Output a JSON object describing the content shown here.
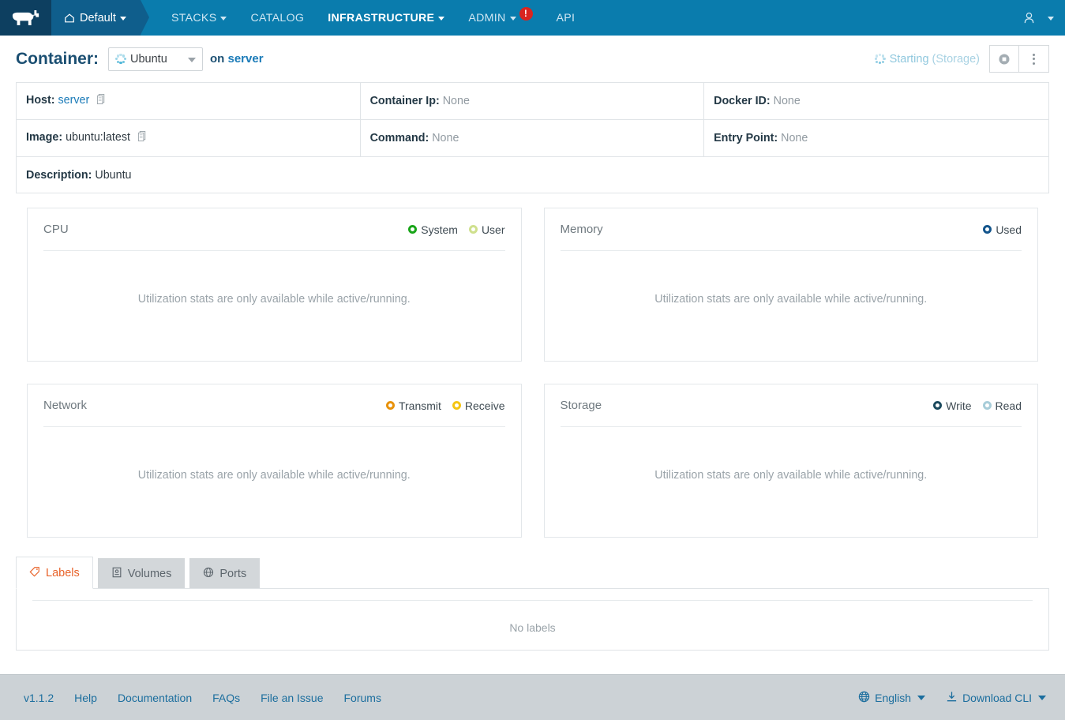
{
  "navbar": {
    "logo_alt": "Rancher",
    "environment": "Default",
    "items": [
      {
        "label": "STACKS",
        "has_caret": true,
        "active": false,
        "badge": null
      },
      {
        "label": "CATALOG",
        "has_caret": false,
        "active": false,
        "badge": null
      },
      {
        "label": "INFRASTRUCTURE",
        "has_caret": true,
        "active": true,
        "badge": null
      },
      {
        "label": "ADMIN",
        "has_caret": true,
        "active": false,
        "badge": "!"
      },
      {
        "label": "API",
        "has_caret": false,
        "active": false,
        "badge": null
      }
    ]
  },
  "header": {
    "title": "Container:",
    "selected_container": "Ubuntu",
    "on_label": "on",
    "host_name": "server",
    "status": "Starting",
    "status_detail": "(Storage)",
    "stop_button_label": "Stop",
    "menu_button_label": "Actions"
  },
  "info": {
    "rows": [
      [
        {
          "label": "Host:",
          "value": "server",
          "value_kind": "link",
          "copy": true
        },
        {
          "label": "Container Ip:",
          "value": "None",
          "value_kind": "muted",
          "copy": false
        },
        {
          "label": "Docker ID:",
          "value": "None",
          "value_kind": "muted",
          "copy": false
        }
      ],
      [
        {
          "label": "Image:",
          "value": "ubuntu:latest",
          "value_kind": "plain",
          "copy": true
        },
        {
          "label": "Command:",
          "value": "None",
          "value_kind": "muted",
          "copy": false
        },
        {
          "label": "Entry Point:",
          "value": "None",
          "value_kind": "muted",
          "copy": false
        }
      ]
    ],
    "description_label": "Description:",
    "description_value": "Ubuntu"
  },
  "graphs": {
    "unavailable_message": "Utilization stats are only available while active/running.",
    "panels": [
      {
        "title": "CPU",
        "legend": [
          {
            "label": "System",
            "color": "#19a519"
          },
          {
            "label": "User",
            "color": "#cfe08d"
          }
        ]
      },
      {
        "title": "Memory",
        "legend": [
          {
            "label": "Used",
            "color": "#13558c"
          }
        ]
      },
      {
        "title": "Network",
        "legend": [
          {
            "label": "Transmit",
            "color": "#e8920b"
          },
          {
            "label": "Receive",
            "color": "#f5c513"
          }
        ]
      },
      {
        "title": "Storage",
        "legend": [
          {
            "label": "Write",
            "color": "#1c4a5e"
          },
          {
            "label": "Read",
            "color": "#a8cdd9"
          }
        ]
      }
    ]
  },
  "tabs": {
    "items": [
      {
        "label": "Labels",
        "icon": "tag-icon",
        "active": true
      },
      {
        "label": "Volumes",
        "icon": "volume-icon",
        "active": false
      },
      {
        "label": "Ports",
        "icon": "globe-icon",
        "active": false
      }
    ],
    "empty_message": "No labels"
  },
  "footer": {
    "links": [
      "v1.1.2",
      "Help",
      "Documentation",
      "FAQs",
      "File an Issue",
      "Forums"
    ],
    "language": "English",
    "download_cli": "Download CLI"
  }
}
